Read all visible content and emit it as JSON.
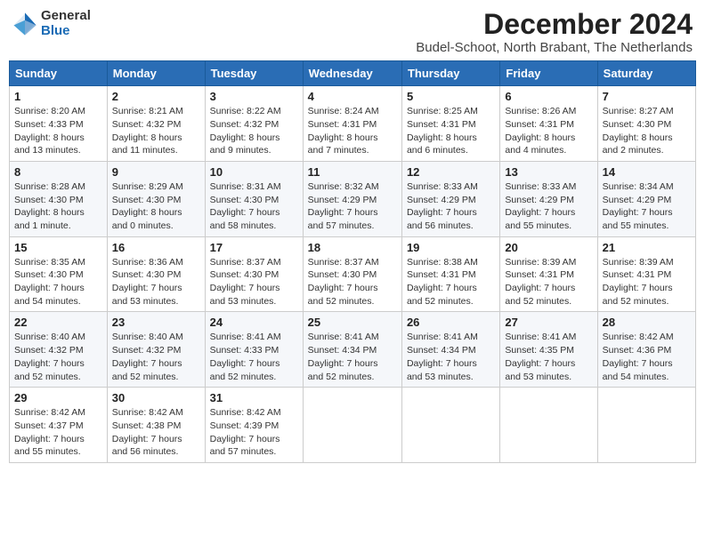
{
  "logo": {
    "general": "General",
    "blue": "Blue"
  },
  "title": "December 2024",
  "subtitle": "Budel-Schoot, North Brabant, The Netherlands",
  "days_of_week": [
    "Sunday",
    "Monday",
    "Tuesday",
    "Wednesday",
    "Thursday",
    "Friday",
    "Saturday"
  ],
  "weeks": [
    [
      {
        "day": "1",
        "info": "Sunrise: 8:20 AM\nSunset: 4:33 PM\nDaylight: 8 hours\nand 13 minutes."
      },
      {
        "day": "2",
        "info": "Sunrise: 8:21 AM\nSunset: 4:32 PM\nDaylight: 8 hours\nand 11 minutes."
      },
      {
        "day": "3",
        "info": "Sunrise: 8:22 AM\nSunset: 4:32 PM\nDaylight: 8 hours\nand 9 minutes."
      },
      {
        "day": "4",
        "info": "Sunrise: 8:24 AM\nSunset: 4:31 PM\nDaylight: 8 hours\nand 7 minutes."
      },
      {
        "day": "5",
        "info": "Sunrise: 8:25 AM\nSunset: 4:31 PM\nDaylight: 8 hours\nand 6 minutes."
      },
      {
        "day": "6",
        "info": "Sunrise: 8:26 AM\nSunset: 4:31 PM\nDaylight: 8 hours\nand 4 minutes."
      },
      {
        "day": "7",
        "info": "Sunrise: 8:27 AM\nSunset: 4:30 PM\nDaylight: 8 hours\nand 2 minutes."
      }
    ],
    [
      {
        "day": "8",
        "info": "Sunrise: 8:28 AM\nSunset: 4:30 PM\nDaylight: 8 hours\nand 1 minute."
      },
      {
        "day": "9",
        "info": "Sunrise: 8:29 AM\nSunset: 4:30 PM\nDaylight: 8 hours\nand 0 minutes."
      },
      {
        "day": "10",
        "info": "Sunrise: 8:31 AM\nSunset: 4:30 PM\nDaylight: 7 hours\nand 58 minutes."
      },
      {
        "day": "11",
        "info": "Sunrise: 8:32 AM\nSunset: 4:29 PM\nDaylight: 7 hours\nand 57 minutes."
      },
      {
        "day": "12",
        "info": "Sunrise: 8:33 AM\nSunset: 4:29 PM\nDaylight: 7 hours\nand 56 minutes."
      },
      {
        "day": "13",
        "info": "Sunrise: 8:33 AM\nSunset: 4:29 PM\nDaylight: 7 hours\nand 55 minutes."
      },
      {
        "day": "14",
        "info": "Sunrise: 8:34 AM\nSunset: 4:29 PM\nDaylight: 7 hours\nand 55 minutes."
      }
    ],
    [
      {
        "day": "15",
        "info": "Sunrise: 8:35 AM\nSunset: 4:30 PM\nDaylight: 7 hours\nand 54 minutes."
      },
      {
        "day": "16",
        "info": "Sunrise: 8:36 AM\nSunset: 4:30 PM\nDaylight: 7 hours\nand 53 minutes."
      },
      {
        "day": "17",
        "info": "Sunrise: 8:37 AM\nSunset: 4:30 PM\nDaylight: 7 hours\nand 53 minutes."
      },
      {
        "day": "18",
        "info": "Sunrise: 8:37 AM\nSunset: 4:30 PM\nDaylight: 7 hours\nand 52 minutes."
      },
      {
        "day": "19",
        "info": "Sunrise: 8:38 AM\nSunset: 4:31 PM\nDaylight: 7 hours\nand 52 minutes."
      },
      {
        "day": "20",
        "info": "Sunrise: 8:39 AM\nSunset: 4:31 PM\nDaylight: 7 hours\nand 52 minutes."
      },
      {
        "day": "21",
        "info": "Sunrise: 8:39 AM\nSunset: 4:31 PM\nDaylight: 7 hours\nand 52 minutes."
      }
    ],
    [
      {
        "day": "22",
        "info": "Sunrise: 8:40 AM\nSunset: 4:32 PM\nDaylight: 7 hours\nand 52 minutes."
      },
      {
        "day": "23",
        "info": "Sunrise: 8:40 AM\nSunset: 4:32 PM\nDaylight: 7 hours\nand 52 minutes."
      },
      {
        "day": "24",
        "info": "Sunrise: 8:41 AM\nSunset: 4:33 PM\nDaylight: 7 hours\nand 52 minutes."
      },
      {
        "day": "25",
        "info": "Sunrise: 8:41 AM\nSunset: 4:34 PM\nDaylight: 7 hours\nand 52 minutes."
      },
      {
        "day": "26",
        "info": "Sunrise: 8:41 AM\nSunset: 4:34 PM\nDaylight: 7 hours\nand 53 minutes."
      },
      {
        "day": "27",
        "info": "Sunrise: 8:41 AM\nSunset: 4:35 PM\nDaylight: 7 hours\nand 53 minutes."
      },
      {
        "day": "28",
        "info": "Sunrise: 8:42 AM\nSunset: 4:36 PM\nDaylight: 7 hours\nand 54 minutes."
      }
    ],
    [
      {
        "day": "29",
        "info": "Sunrise: 8:42 AM\nSunset: 4:37 PM\nDaylight: 7 hours\nand 55 minutes."
      },
      {
        "day": "30",
        "info": "Sunrise: 8:42 AM\nSunset: 4:38 PM\nDaylight: 7 hours\nand 56 minutes."
      },
      {
        "day": "31",
        "info": "Sunrise: 8:42 AM\nSunset: 4:39 PM\nDaylight: 7 hours\nand 57 minutes."
      },
      null,
      null,
      null,
      null
    ]
  ]
}
